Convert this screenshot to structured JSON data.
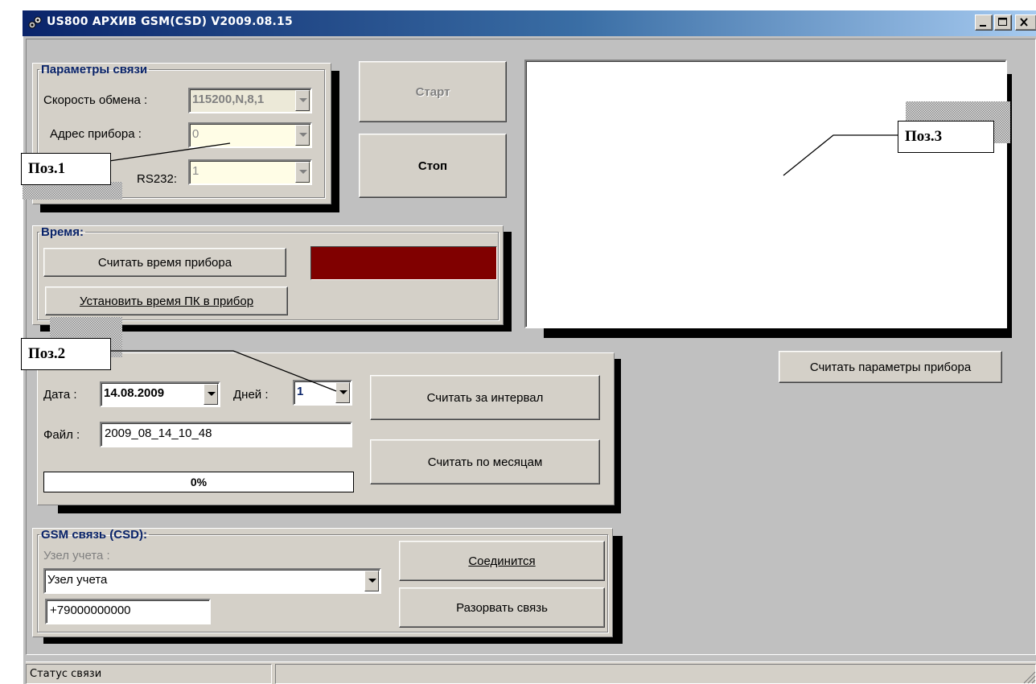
{
  "window": {
    "title": "US800 АРХИВ GSM(CSD) V2009.08.15",
    "icon": "app-icon",
    "caption_buttons": [
      "minimize-icon",
      "maximize-icon",
      "close-icon"
    ]
  },
  "comm_params": {
    "legend": "Параметры связи",
    "speed_label": "Скорость обмена :",
    "speed_value": "115200,N,8,1",
    "address_label": "Адрес прибора :",
    "address_value": "0",
    "port_label": "RS232:",
    "port_value": "1"
  },
  "controls": {
    "start_label": "Старт",
    "stop_label": "Стоп"
  },
  "time": {
    "legend": "Время:",
    "read_time_label": "Считать время прибора",
    "set_time_label": "Установить время ПК в прибор",
    "display_color": "#800000"
  },
  "archive": {
    "date_label": "Дата :",
    "date_value": "14.08.2009",
    "days_label": "Дней :",
    "days_value": "1",
    "file_label": "Файл :",
    "file_value": "2009_08_14_10_48",
    "progress_text": "0%",
    "progress": 0,
    "read_interval_label": "Считать за интервал",
    "read_months_label": "Считать по месяцам"
  },
  "gsm": {
    "legend": "GSM связь (CSD):",
    "node_label": "Узел учета :",
    "node_value": "Узел учета",
    "phone_value": "+79000000000",
    "connect_label": "Соединится",
    "disconnect_label": "Разорвать связь"
  },
  "read_params_label": "Считать параметры прибора",
  "annotations": {
    "pos1": "Поз.1",
    "pos2": "Поз.2",
    "pos3": "Поз.3"
  },
  "status": {
    "text": "Статус связи"
  },
  "colors": {
    "titlebar_start": "#0a246a",
    "group_legend": "#0a246a",
    "time_display": "#800000"
  }
}
